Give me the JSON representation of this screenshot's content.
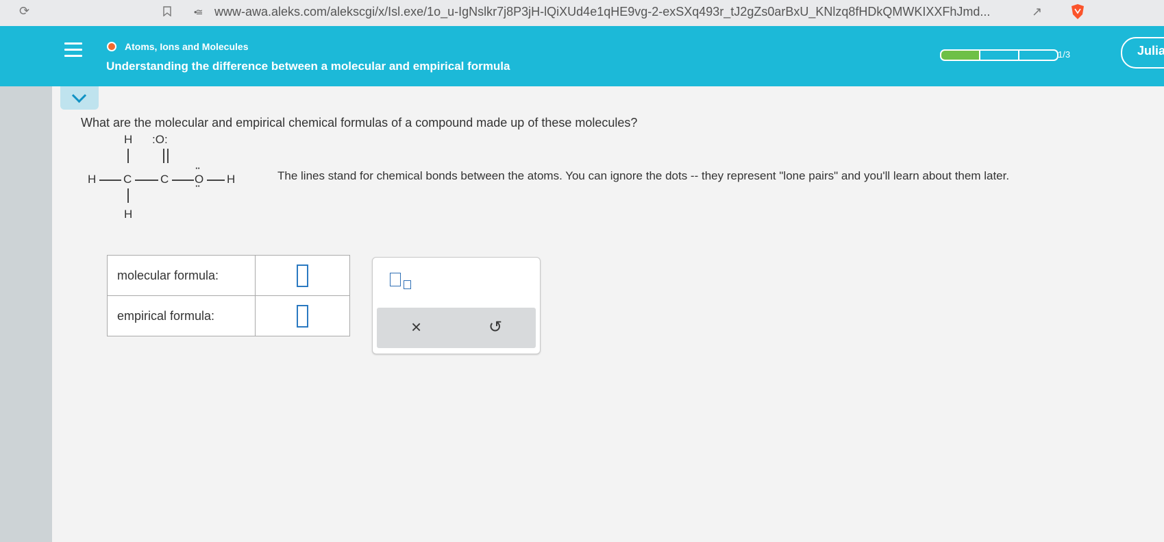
{
  "browser": {
    "url": "www-awa.aleks.com/alekscgi/x/Isl.exe/1o_u-IgNslkr7j8P3jH-lQiXUd4e1qHE9vg-2-exSXq493r_tJ2gZs0arBxU_KNlzq8fHDkQMWKIXXFhJmd..."
  },
  "header": {
    "topic": "Atoms, Ions and Molecules",
    "lesson_title": "Understanding the difference between a molecular and empirical formula",
    "progress": {
      "completed": 1,
      "total": 3,
      "label": "1/3"
    },
    "user_name": "Julia",
    "accent_color": "#1cb9d8",
    "topic_dot_color": "#f26a2e",
    "progress_fill_color": "#6ec047"
  },
  "question": {
    "prompt": "What are the molecular and empirical chemical formulas of a compound made up of these molecules?",
    "structure_atoms": {
      "h_top": "H",
      "o_double": ":O:",
      "h_left": "H",
      "c1": "C",
      "c2": "C",
      "o_single": "O",
      "o_dots_top": "··",
      "o_dots_bottom": "··",
      "h_right": "H",
      "h_bottom": "H"
    },
    "note": "The lines stand for chemical bonds between the atoms. You can ignore the dots -- they represent \"lone pairs\" and you'll learn about them later."
  },
  "answers": {
    "molecular_label": "molecular formula:",
    "molecular_value": "",
    "empirical_label": "empirical formula:",
    "empirical_value": ""
  },
  "palette": {
    "subscript_icon": "subscript-template-icon",
    "clear_label": "×",
    "undo_label": "↺"
  }
}
